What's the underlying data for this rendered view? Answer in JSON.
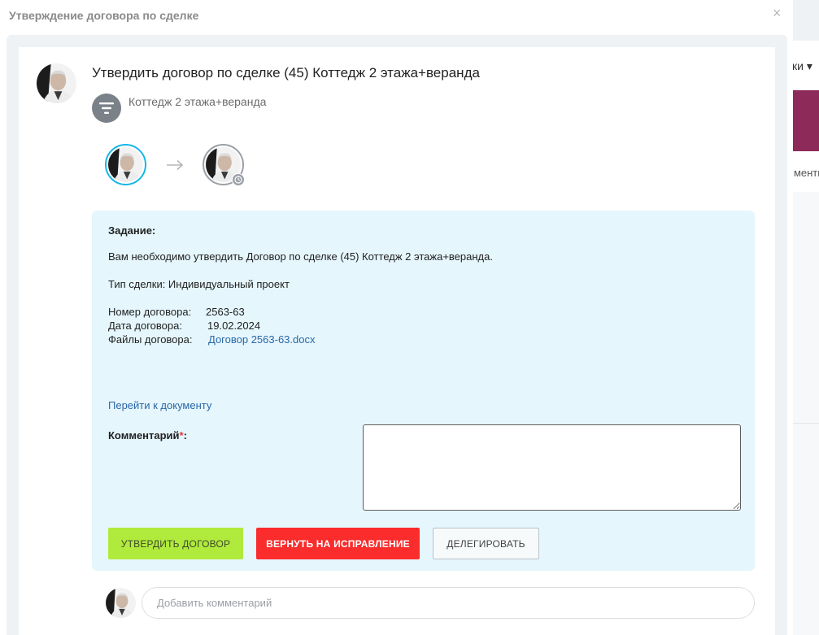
{
  "modal": {
    "title": "Утверждение договора по сделке",
    "close_label": "×"
  },
  "task": {
    "title": "Утвердить договор по сделке (45) Коттедж 2 этажа+веранда",
    "subtitle": "Коттедж 2 этажа+веранда"
  },
  "panel": {
    "task_label": "Задание:",
    "description": "Вам необходимо  утвердить Договор по сделке (45) Коттедж 2 этажа+веранда.",
    "deal_type": "Тип сделки: Индивидуальный проект",
    "contract_number_label": "Номер договора:",
    "contract_number": "2563-63",
    "contract_date_label": "Дата договора:",
    "contract_date": "19.02.2024",
    "contract_files_label": "Файлы договора:",
    "contract_file": "Договор 2563-63.docx",
    "go_to_document": "Перейти к документу",
    "comment_label": "Комментарий",
    "comment_required_mark": "*",
    "comment_colon": ":",
    "comment_value": ""
  },
  "buttons": {
    "approve": "УТВЕРДИТЬ ДОГОВОР",
    "return": "ВЕРНУТЬ НА ИСПРАВЛЕНИЕ",
    "delegate": "ДЕЛЕГИРОВАТЬ"
  },
  "comment_bar": {
    "placeholder": "Добавить комментарий",
    "value": ""
  },
  "background_app": {
    "tab_fragment": "ски ▾",
    "column_fragment": "мменти"
  },
  "colors": {
    "accent_blue": "#16b6e6",
    "panel_bg": "#e5f6fc",
    "approve_green": "#b0ea3c",
    "return_red": "#fa2c2c",
    "link_blue": "#2a67a8",
    "bg_purple": "#8e2a5a"
  },
  "icons": {
    "close": "close-icon",
    "filter": "filter-icon",
    "arrow": "arrow-right-icon",
    "clock": "clock-icon"
  }
}
